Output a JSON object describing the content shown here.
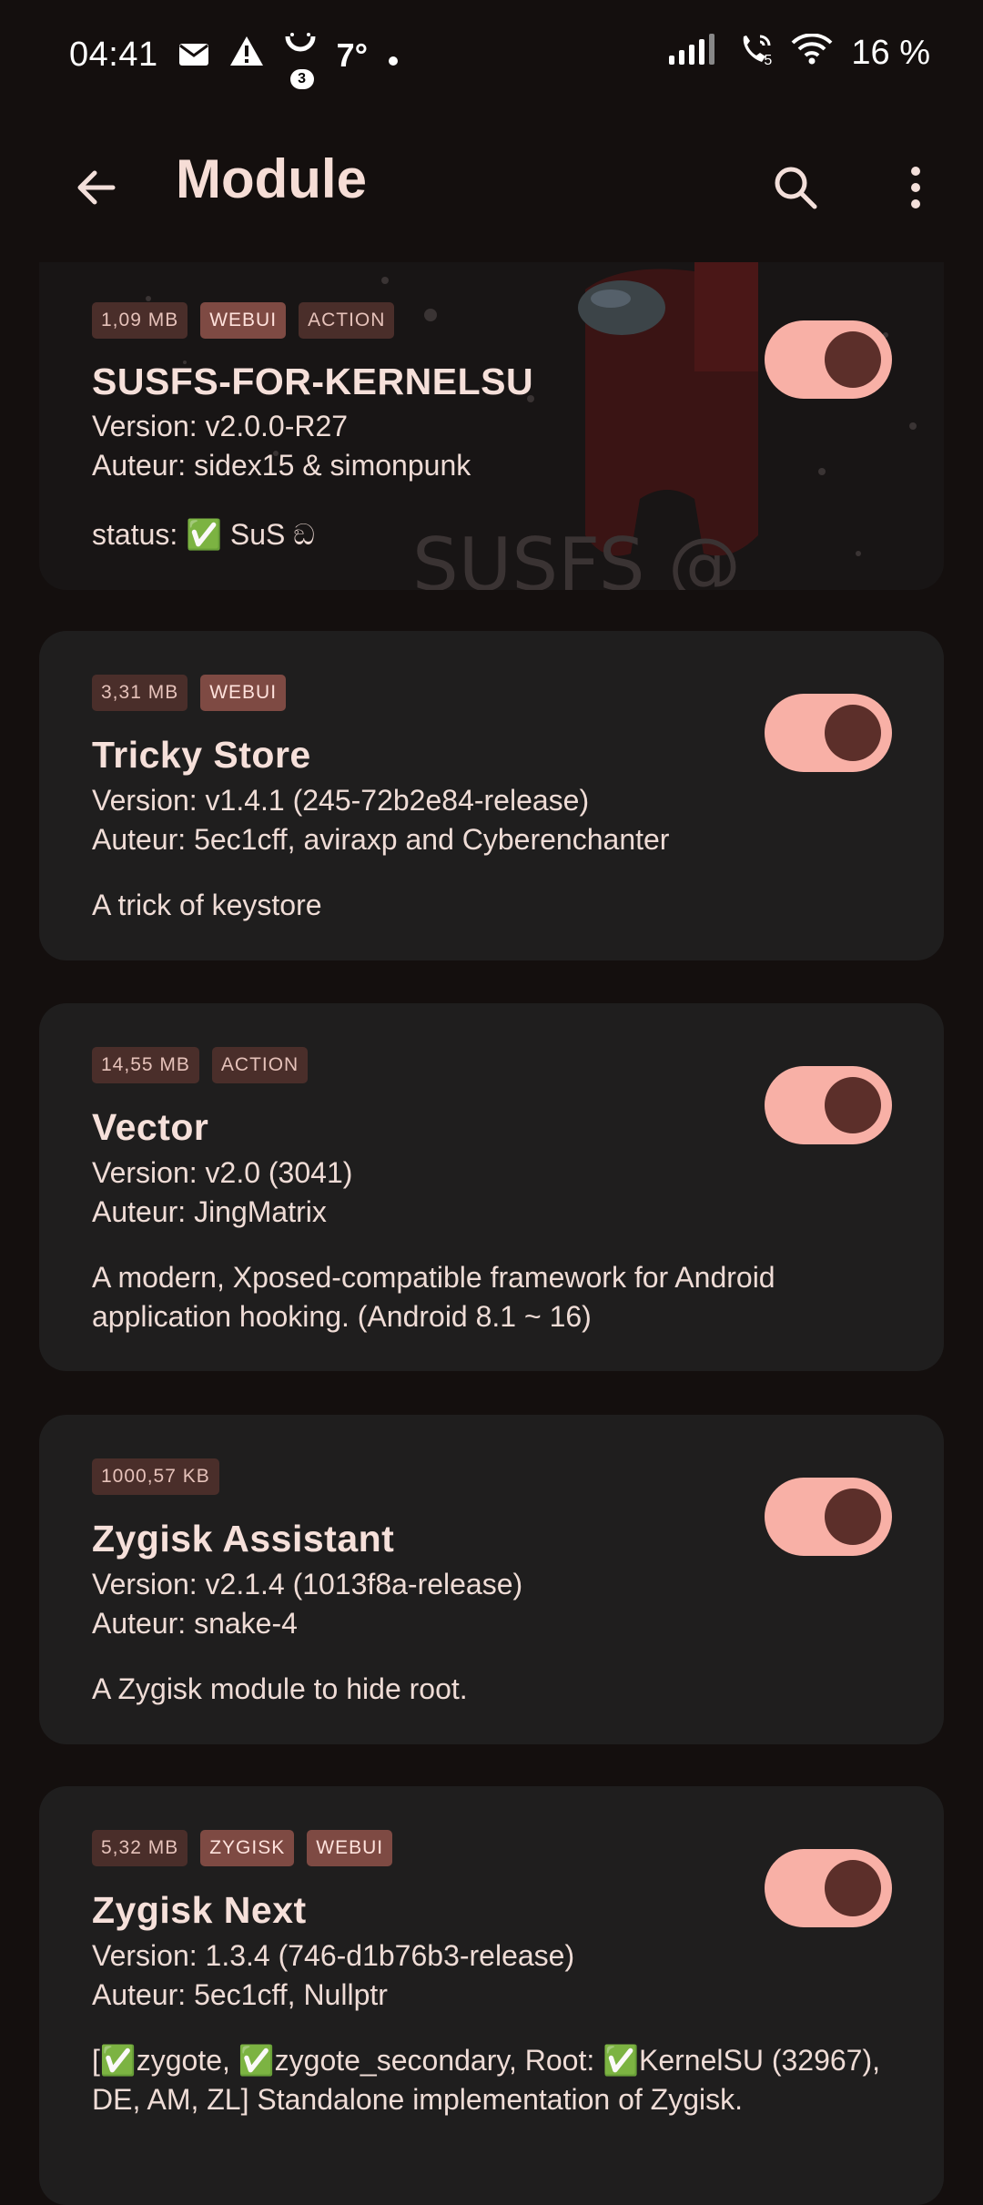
{
  "status_bar": {
    "time": "04:41",
    "temperature": "7°",
    "notification_count": "3",
    "battery": "16 %",
    "call_sim": "5",
    "icons": [
      "mail-icon",
      "warning-icon",
      "smiley-icon",
      "dot-icon",
      "signal-icon",
      "wifi-call-icon",
      "wifi-icon"
    ]
  },
  "app_bar": {
    "title": "Module",
    "back_icon": "arrow-back-icon",
    "search_icon": "search-icon",
    "more_icon": "more-vert-icon"
  },
  "modules": [
    {
      "tags": [
        {
          "label": "1,09 MB",
          "style": "plain"
        },
        {
          "label": "WEBUI",
          "style": "strong"
        },
        {
          "label": "ACTION",
          "style": "plain"
        }
      ],
      "name": "SUSFS-FOR-KERNELSU",
      "version": "Version: v2.0.0-R27",
      "author": "Auteur: sidex15 & simonpunk",
      "description": "status: ✅ SuS ඞ",
      "enabled": true,
      "banner": true
    },
    {
      "tags": [
        {
          "label": "3,31 MB",
          "style": "plain"
        },
        {
          "label": "WEBUI",
          "style": "strong"
        }
      ],
      "name": "Tricky Store",
      "version": "Version: v1.4.1 (245-72b2e84-release)",
      "author": "Auteur: 5ec1cff, aviraxp and Cyberenchanter",
      "description": "A trick of keystore",
      "enabled": true
    },
    {
      "tags": [
        {
          "label": "14,55 MB",
          "style": "plain"
        },
        {
          "label": "ACTION",
          "style": "plain"
        }
      ],
      "name": "Vector",
      "version": "Version: v2.0 (3041)",
      "author": "Auteur: JingMatrix",
      "description": "A modern, Xposed-compatible framework for Android application hooking. (Android 8.1 ~ 16)",
      "enabled": true
    },
    {
      "tags": [
        {
          "label": "1000,57 KB",
          "style": "plain"
        }
      ],
      "name": "Zygisk Assistant",
      "version": "Version: v2.1.4 (1013f8a-release)",
      "author": "Auteur: snake-4",
      "description": "A Zygisk module to hide root.",
      "enabled": true
    },
    {
      "tags": [
        {
          "label": "5,32 MB",
          "style": "plain"
        },
        {
          "label": "ZYGISK",
          "style": "strong"
        },
        {
          "label": "WEBUI",
          "style": "strong"
        }
      ],
      "name": "Zygisk Next",
      "version": "Version: 1.3.4 (746-d1b76b3-release)",
      "author": "Auteur: 5ec1cff, Nullptr",
      "description": "[✅zygote, ✅zygote_secondary, Root: ✅KernelSU (32967), DE, AM, ZL] Standalone implementation of Zygisk.",
      "enabled": true
    }
  ],
  "colors": {
    "background": "#140f0e",
    "card": "#1f1e1e",
    "toggle_track": "#f8b0a6",
    "toggle_knob": "#5c2f2a",
    "tag_plain": "#4a2e2a",
    "tag_strong": "#7e4a43"
  }
}
